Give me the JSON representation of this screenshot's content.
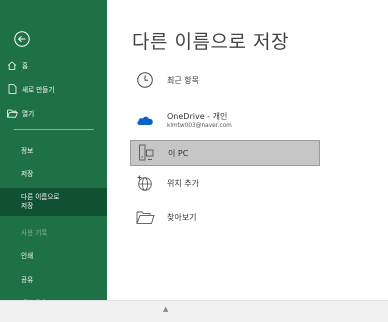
{
  "page_title": "다른 이름으로 저장",
  "sidebar": {
    "back_icon": "back-arrow-circle-icon",
    "items": [
      {
        "label": "홈",
        "icon": "home-icon"
      },
      {
        "label": "새로 만들기",
        "icon": "new-document-icon"
      },
      {
        "label": "열기",
        "icon": "open-folder-icon"
      },
      {
        "label": "정보"
      },
      {
        "label": "저장"
      },
      {
        "label": "다른 이름으로\n저장",
        "selected": true
      },
      {
        "label": "사용 기록",
        "disabled": true
      },
      {
        "label": "인쇄"
      },
      {
        "label": "공유"
      },
      {
        "label": "내보내기"
      }
    ]
  },
  "locations": [
    {
      "label": "최근 항목",
      "icon": "clock-icon"
    },
    {
      "label": "OneDrive - 개인",
      "sub": "kimtw003@naver.com",
      "icon": "onedrive-cloud-icon"
    },
    {
      "label": "이 PC",
      "icon": "pc-icon",
      "selected": true
    },
    {
      "label": "위치 추가",
      "icon": "add-place-globe-icon"
    },
    {
      "label": "찾아보기",
      "icon": "browse-folder-icon"
    }
  ],
  "colors": {
    "sidebar": "#1e7145",
    "sidebar_selected": "#0f5130",
    "selected_item": "#c6c6c6"
  }
}
